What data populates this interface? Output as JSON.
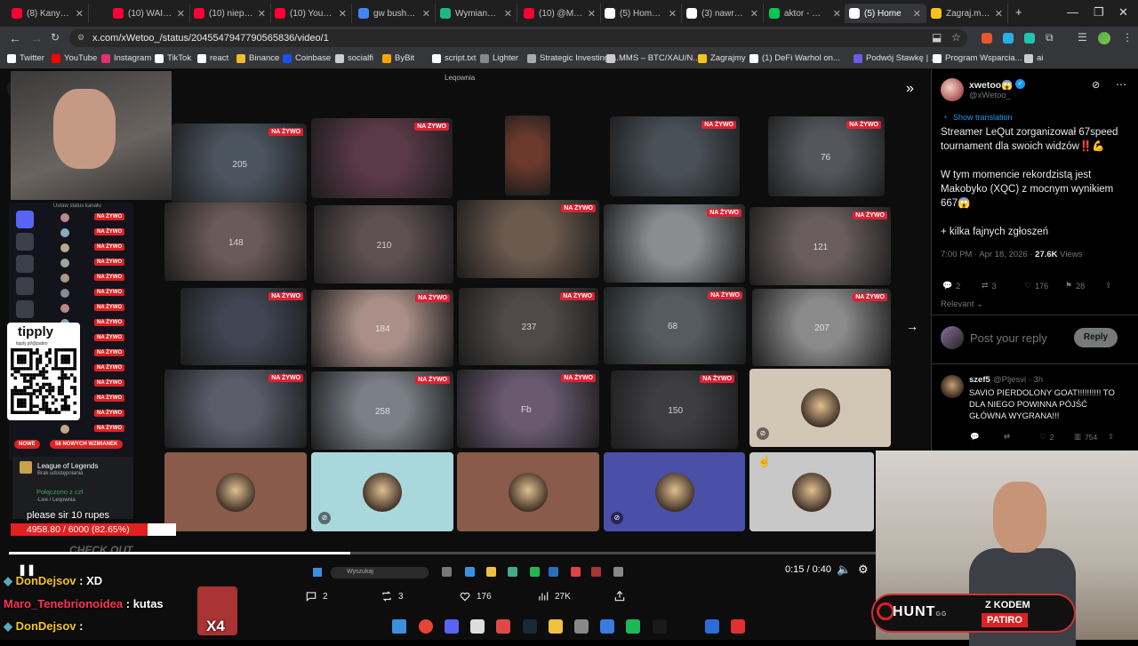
{
  "browser": {
    "tabs": [
      {
        "label": "(8) Kanye We",
        "color": "#ff0033"
      },
      {
        "label": "(10) WAIMA",
        "color": "#ff0033"
      },
      {
        "label": "(10) niepocz",
        "color": "#ff0033"
      },
      {
        "label": "(10) YouTube",
        "color": "#ff0033"
      },
      {
        "label": "gw bush cig",
        "color": "#4285f4"
      },
      {
        "label": "Wymiana Ro",
        "color": "#1eb980"
      },
      {
        "label": "(10) @Millen",
        "color": "#ff0033"
      },
      {
        "label": "(5) Home / X",
        "color": "#000000"
      },
      {
        "label": "(3) nawrocki",
        "color": "#000000"
      },
      {
        "label": "aktor - Wats",
        "color": "#00c853"
      },
      {
        "label": "(5) Home",
        "color": "#000000"
      },
      {
        "label": "Zagraj.my -",
        "color": "#f5c518"
      }
    ],
    "url": "x.com/xWetoo_/status/2045547947790565836/video/1",
    "bookmarks": [
      "Twitter",
      "YouTube",
      "Instagram",
      "TikTok",
      "react",
      "Binance",
      "Coinbase",
      "socialfi",
      "ByBit",
      "script.txt",
      "Lighter",
      "Strategic Investing a...",
      "MMS – BTC/XAU/N...",
      "Zagrajmy",
      "(1) DeFi Warhol on...",
      "Podwój Stawkę | ...",
      "Program Wsparcia...",
      "ai"
    ]
  },
  "video": {
    "window_title": "Leqownia",
    "live_badge": "NA ŻYWO",
    "tiles": [
      {
        "num": "205",
        "live": true,
        "color": "#4b5560"
      },
      {
        "num": "",
        "live": true,
        "color": "#5b3a48"
      },
      {
        "num": "",
        "live": false,
        "color": "#6c3a2c"
      },
      {
        "num": "",
        "live": true,
        "color": "#485058"
      },
      {
        "num": "76",
        "live": true,
        "color": "#53575c"
      },
      {
        "num": "148",
        "live": false,
        "color": "#6a5a58"
      },
      {
        "num": "210",
        "live": false,
        "color": "#5d4f52"
      },
      {
        "num": "",
        "live": true,
        "color": "#6b5a4e"
      },
      {
        "num": "",
        "live": true,
        "color": "#8a8c90"
      },
      {
        "num": "121",
        "live": true,
        "color": "#6a5d5e"
      },
      {
        "num": "",
        "live": true,
        "color": "#3f4552"
      },
      {
        "num": "184",
        "live": true,
        "color": "#a98f88"
      },
      {
        "num": "237",
        "live": true,
        "color": "#4f4a48"
      },
      {
        "num": "68",
        "live": true,
        "color": "#555c60"
      },
      {
        "num": "207",
        "live": true,
        "color": "#8a8a8a"
      },
      {
        "num": "",
        "live": true,
        "color": "#5a5c6a"
      },
      {
        "num": "258",
        "live": true,
        "color": "#7a8088"
      },
      {
        "num": "Fb",
        "live": true,
        "color": "#6a5a70"
      },
      {
        "num": "150",
        "live": true,
        "color": "#3e3e42"
      },
      {
        "num": "",
        "live": false,
        "color": "#d2c6b5"
      },
      {
        "num": "",
        "live": false,
        "color": "#8a5a4a"
      },
      {
        "num": "",
        "live": false,
        "color": "#a8d8dc"
      },
      {
        "num": "",
        "live": false,
        "color": "#8a5a4a"
      },
      {
        "num": "",
        "live": false,
        "color": "#4a4fa8"
      },
      {
        "num": "",
        "live": false,
        "color": "#c8c8c8"
      }
    ],
    "time": "0:15 / 0:40",
    "progress_fraction": 0.375
  },
  "overlay": {
    "status_label": "Ustaw status kanału",
    "tipply_name": "tipply",
    "tipply_url": "tipply.pl/@patiro",
    "nowe_label": "NOWE",
    "nowych_label": "58 NOWYCH WZMIANEK",
    "lol_title": "League of Legends",
    "lol_sub": "Brak udostępniania",
    "conn": "Połączono z czł",
    "conn_sub": "-Live / Leqownia",
    "tts_text": "please sir 10 rupes",
    "hp_text": "4958.80 / 6000 (82.65%)",
    "hp_fraction": 0.8265,
    "check_out": "CHECK OUT",
    "hunt_logo": "HUNT",
    "hunt_gg": "GG",
    "hunt_kod": "Z KODEM",
    "hunt_code": "PATIRO",
    "x4": "X4",
    "search_placeholder": "Wyszukaj"
  },
  "chat": [
    {
      "user": "DonDejsov",
      "msg": "XD",
      "color": "#f5c518"
    },
    {
      "user": "Maro_Tenebrionoidea",
      "msg": "kutas",
      "color": "#ff3355"
    },
    {
      "user": "DonDejsov",
      "msg": "",
      "color": "#f5c518"
    }
  ],
  "tweet_actions": {
    "replies": "2",
    "retweets": "3",
    "likes": "176",
    "views": "27K"
  },
  "tweet": {
    "name": "xwetoo😱",
    "handle": "@xWetoo_",
    "translate": "Show translation",
    "text1": "Streamer LeQut zorganizował 67speed tournament dla swoich widzów‼️💪",
    "text2": "W tym momencie rekordzistą jest Makobyko (XQC) z mocnym wynikiem 667😱",
    "text3": "+ kilka fajnych zgłoszeń",
    "time": "7:00 PM · Apr 18, 2026 ·",
    "views": "27.6K",
    "views_label": "Views",
    "stats": {
      "replies": "2",
      "retweets": "3",
      "likes": "176",
      "bookmarks": "28"
    },
    "relevant": "Relevant",
    "reply_placeholder": "Post your reply",
    "reply_button": "Reply"
  },
  "reply": {
    "name": "szef5",
    "handle": "@Pljesvi · 3h",
    "text": "SAVIO PIERDOLONY GOAT!!!!!!!!!! TO DLA NIEGO POWINNA PÓJŚĆ GŁÓWNA WYGRANA!!!",
    "stats": {
      "likes": "2",
      "views": "754"
    }
  }
}
